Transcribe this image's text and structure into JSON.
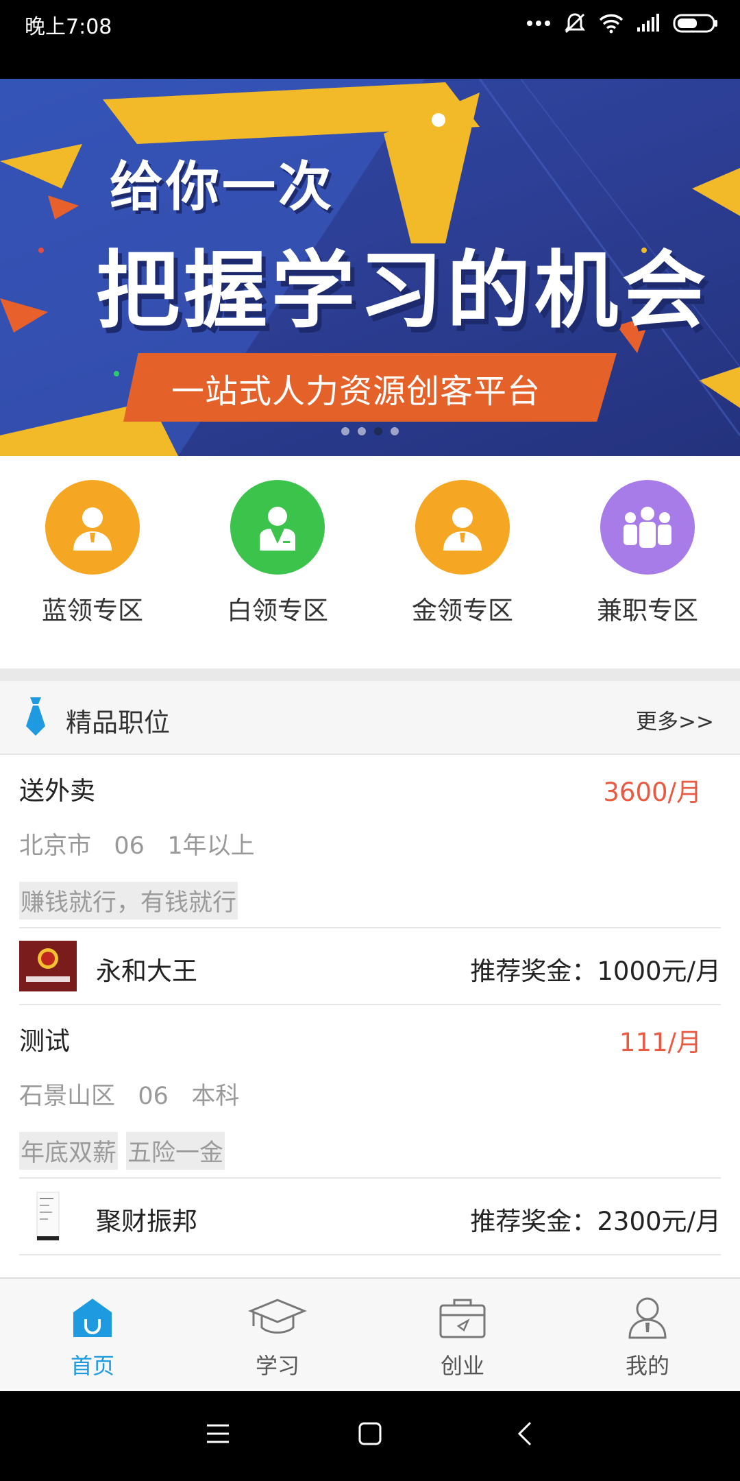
{
  "status_bar": {
    "time": "晚上7:08",
    "icons": [
      "more-dots-icon",
      "mute-icon",
      "wifi-icon",
      "signal-icon",
      "battery-icon"
    ]
  },
  "banner": {
    "line_small": "给你一次",
    "line_big": "把握学习的机会",
    "ribbon": "一站式人力资源创客平台",
    "slide_count": 4,
    "active_slide": 3
  },
  "categories": [
    {
      "label": "蓝领专区",
      "icon": "blue-collar-person-icon",
      "color": "#f5a623"
    },
    {
      "label": "白领专区",
      "icon": "white-collar-person-icon",
      "color": "#3cc34b"
    },
    {
      "label": "金领专区",
      "icon": "gold-collar-person-icon",
      "color": "#f5a623"
    },
    {
      "label": "兼职专区",
      "icon": "part-time-group-icon",
      "color": "#a77ce8"
    }
  ],
  "section": {
    "title": "精品职位",
    "more": "更多>>",
    "icon": "necktie-icon"
  },
  "jobs": [
    {
      "title": "送外卖",
      "salary": "3600/月",
      "location": "北京市",
      "code": "06",
      "requirement": "1年以上",
      "tags": [
        "赚钱就行，有钱就行"
      ],
      "company": "永和大王",
      "bonus": "推荐奖金：1000元/月"
    },
    {
      "title": "测试",
      "salary": "111/月",
      "location": "石景山区",
      "code": "06",
      "requirement": "本科",
      "tags": [
        "年底双薪",
        "五险一金"
      ],
      "company": "聚财振邦",
      "bonus": "推荐奖金：2300元/月"
    }
  ],
  "bottom_nav": [
    {
      "label": "首页",
      "icon": "home-icon",
      "active": true
    },
    {
      "label": "学习",
      "icon": "graduation-cap-icon",
      "active": false
    },
    {
      "label": "创业",
      "icon": "briefcase-icon",
      "active": false
    },
    {
      "label": "我的",
      "icon": "profile-icon",
      "active": false
    }
  ],
  "colors": {
    "accent": "#1e9be0",
    "salary": "#e85a42",
    "banner_blue": "#2d3f96",
    "ribbon_orange": "#e4622a"
  }
}
